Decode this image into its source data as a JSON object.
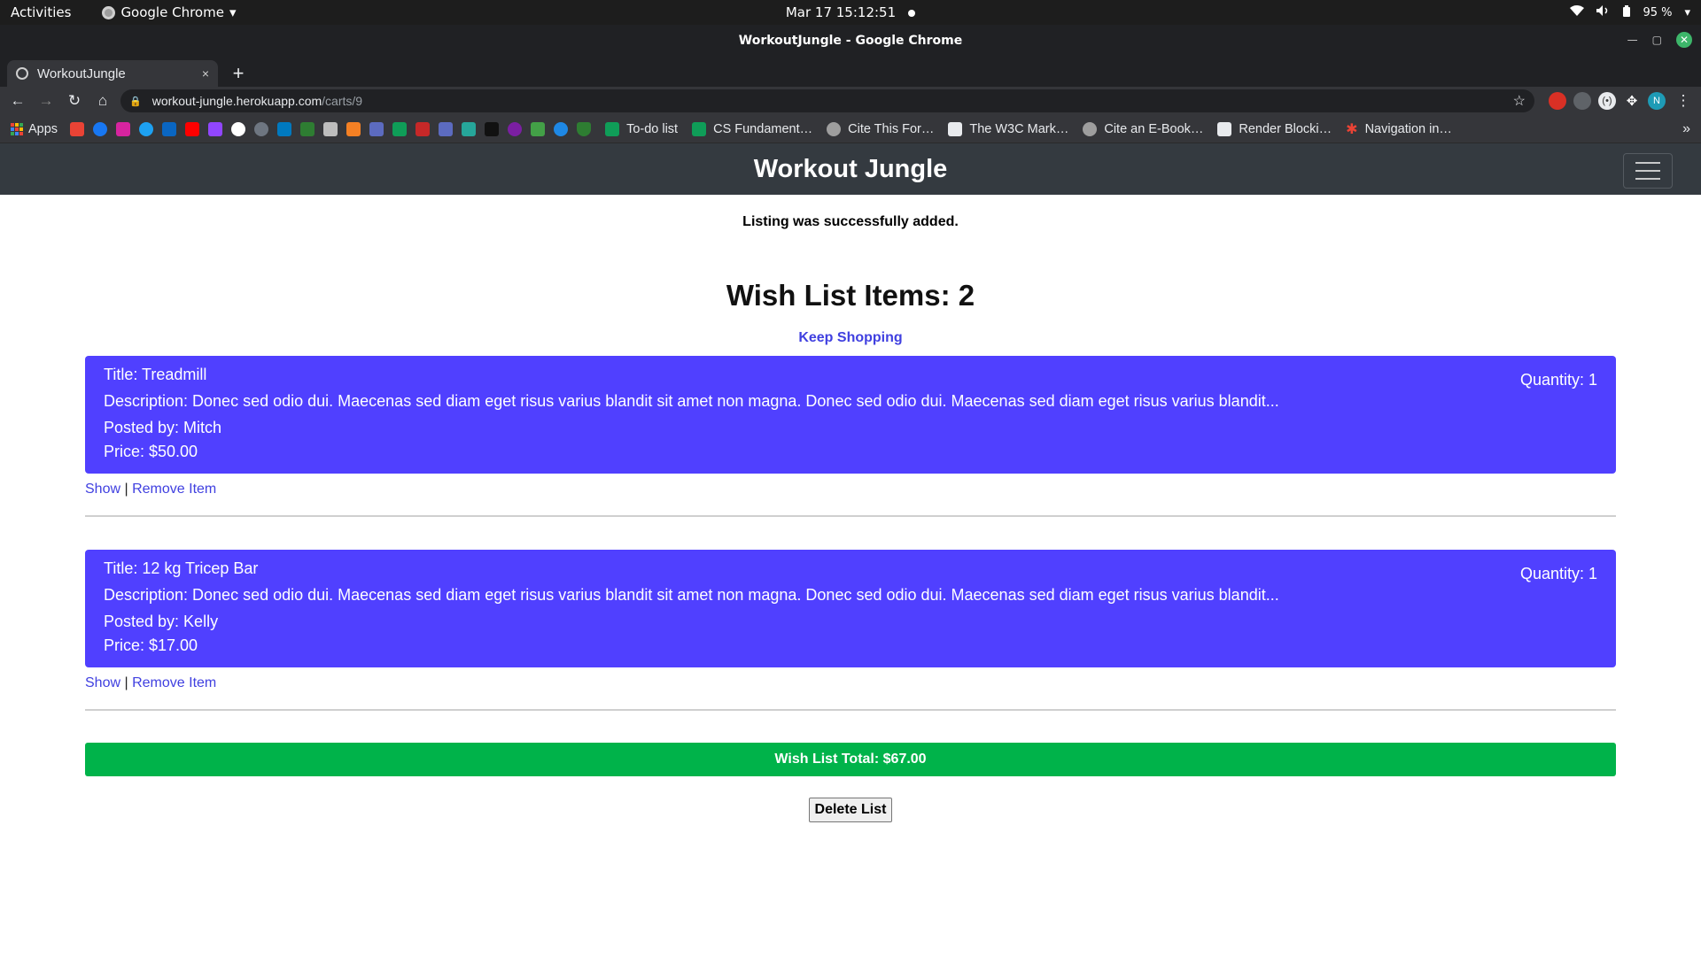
{
  "os": {
    "activities": "Activities",
    "app_name": "Google Chrome",
    "clock": "Mar 17  15:12:51",
    "battery": "95 %"
  },
  "window": {
    "title": "WorkoutJungle - Google Chrome"
  },
  "tab": {
    "title": "WorkoutJungle",
    "close": "×",
    "new": "+"
  },
  "address": {
    "host": "workout-jungle.herokuapp.com",
    "path": "/carts/9"
  },
  "bookmarks": {
    "apps_label": "Apps",
    "items": [
      {
        "label": "To-do list",
        "color": "#0f9d58"
      },
      {
        "label": "CS Fundament…",
        "color": "#0f9d58"
      },
      {
        "label": "Cite This For…",
        "color": "#9e9e9e"
      },
      {
        "label": "The W3C Mark…",
        "color": "#e8eaed"
      },
      {
        "label": "Cite an E-Book…",
        "color": "#9e9e9e"
      },
      {
        "label": "Render Blocki…",
        "color": "#e8eaed"
      },
      {
        "label": "Navigation in…",
        "color": "#ea4335"
      }
    ],
    "more": "»"
  },
  "site": {
    "brand": "Workout Jungle",
    "flash": "Listing was successfully added.",
    "heading": "Wish List Items: 2",
    "keep_shopping": "Keep Shopping",
    "items": [
      {
        "title": "Title: Treadmill",
        "quantity": "Quantity: 1",
        "description": "Description: Donec sed odio dui. Maecenas sed diam eget risus varius blandit sit amet non magna. Donec sed odio dui. Maecenas sed diam eget risus varius blandit...",
        "posted_by": "Posted by: Mitch",
        "price": "Price: $50.00",
        "show": "Show",
        "separator": "|",
        "remove": "Remove Item"
      },
      {
        "title": "Title: 12 kg Tricep Bar",
        "quantity": "Quantity: 1",
        "description": "Description: Donec sed odio dui. Maecenas sed diam eget risus varius blandit sit amet non magna. Donec sed odio dui. Maecenas sed diam eget risus varius blandit...",
        "posted_by": "Posted by: Kelly",
        "price": "Price: $17.00",
        "show": "Show",
        "separator": "|",
        "remove": "Remove Item"
      }
    ],
    "total": "Wish List Total: $67.00",
    "delete": "Delete List"
  },
  "colors": {
    "card": "#5040ff",
    "total": "#00b34a",
    "navbar": "#343a40",
    "link": "#4040e0"
  }
}
